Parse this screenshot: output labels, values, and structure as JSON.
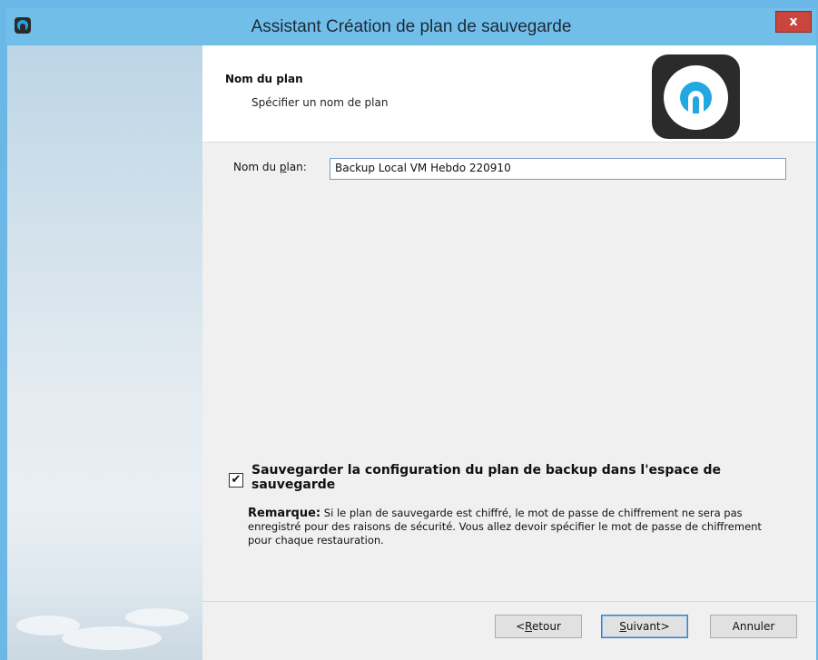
{
  "window": {
    "title": "Assistant Création de plan de sauvegarde",
    "close_label": "x",
    "accent_color": "#71bfe9",
    "close_color": "#c9453d",
    "icons": [
      "app-icon",
      "close-icon",
      "logo-icon",
      "checkmark-icon"
    ]
  },
  "header": {
    "title": "Nom du plan",
    "subtitle": "Spécifier un nom de plan"
  },
  "form": {
    "name_label_prefix": "Nom du ",
    "name_label_accel": "p",
    "name_label_suffix": "lan:",
    "name_value": "Backup Local VM Hebdo 220910"
  },
  "option": {
    "checked": true,
    "check_mark": "✔",
    "label": "Sauvegarder la configuration du plan de backup dans l'espace de sauvegarde",
    "note_title": "Remarque:",
    "note_text": " Si le plan de sauvegarde est chiffré, le mot de passe de chiffrement ne sera pas enregistré pour des raisons de sécurité. Vous allez devoir spécifier le mot de passe de chiffrement pour chaque restauration."
  },
  "buttons": {
    "back_prefix": "<",
    "back_accel": "R",
    "back_suffix": "etour",
    "next_accel": "S",
    "next_suffix": "uivant>",
    "cancel": "Annuler"
  }
}
